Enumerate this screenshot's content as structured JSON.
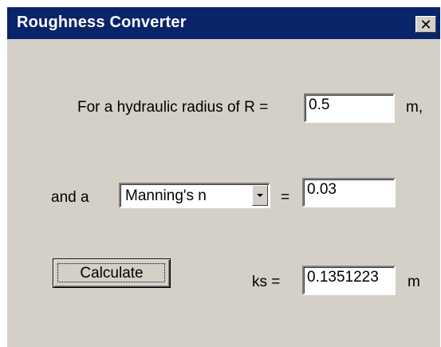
{
  "window": {
    "title": "Roughness Converter",
    "close_glyph": "✕"
  },
  "row1": {
    "label": "For a hydraulic radius of R =",
    "value": "0.5",
    "unit": "m,"
  },
  "row2": {
    "prefix": "and a",
    "dropdown_selected": "Manning's n",
    "equals": "=",
    "value": "0.03"
  },
  "row3": {
    "button_label": "Calculate",
    "result_label": "ks =",
    "result_value": "0.1351223",
    "unit": "m"
  }
}
